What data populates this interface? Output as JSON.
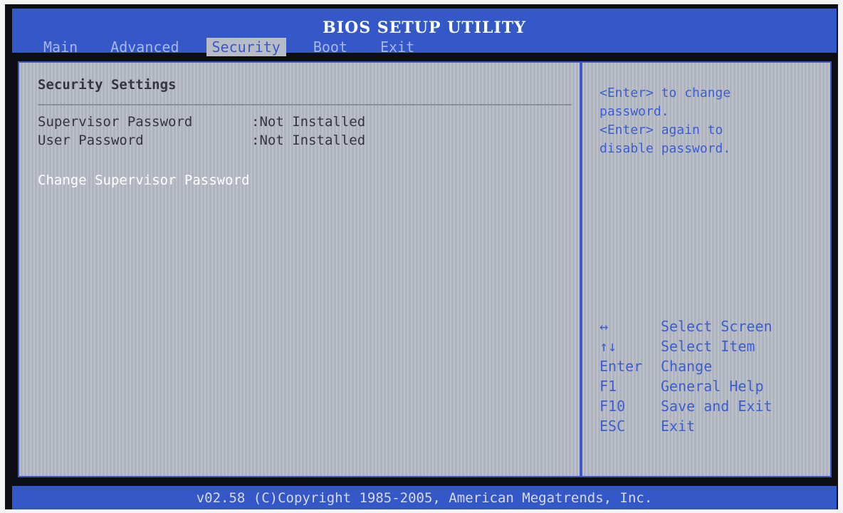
{
  "header": {
    "title": "BIOS SETUP UTILITY",
    "tabs": [
      {
        "label": "Main",
        "active": false
      },
      {
        "label": "Advanced",
        "active": false
      },
      {
        "label": "Security",
        "active": true
      },
      {
        "label": "Boot",
        "active": false
      },
      {
        "label": "Exit",
        "active": false
      }
    ]
  },
  "main": {
    "section_title": "Security Settings",
    "settings": [
      {
        "label": "Supervisor Password",
        "value": ":Not Installed"
      },
      {
        "label": "User Password",
        "value": ":Not Installed"
      }
    ],
    "change_supervisor": "Change Supervisor Password"
  },
  "help": {
    "lines": [
      "<Enter> to change",
      "password.",
      "<Enter> again to",
      "disable password."
    ]
  },
  "keys": [
    {
      "key": "↔",
      "action": "Select Screen"
    },
    {
      "key": "↑↓",
      "action": "Select Item"
    },
    {
      "key": "Enter",
      "action": "Change"
    },
    {
      "key": "F1",
      "action": "General Help"
    },
    {
      "key": "F10",
      "action": "Save and Exit"
    },
    {
      "key": "ESC",
      "action": "Exit"
    }
  ],
  "footer": {
    "copyright": "v02.58 (C)Copyright 1985-2005, American Megatrends, Inc."
  },
  "colors": {
    "accent_blue": "#3558c8",
    "panel_gray": "#b4b9c3",
    "help_text": "#3b5ed1",
    "selected_text": "#ffffff"
  }
}
